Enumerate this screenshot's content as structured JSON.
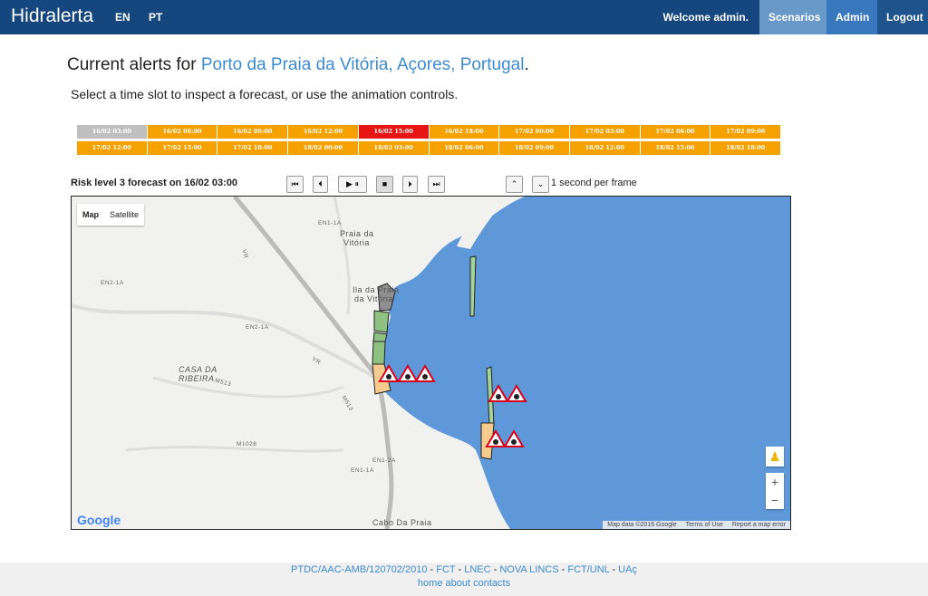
{
  "navbar": {
    "brand": "Hidralerta",
    "lang_en": "EN",
    "lang_pt": "PT",
    "welcome": "Welcome admin.",
    "scenarios": "Scenarios",
    "admin": "Admin",
    "logout": "Logout"
  },
  "header": {
    "title_prefix": "Current alerts for ",
    "location": "Porto da Praia da Vitória, Açores, Portugal",
    "title_suffix": ".",
    "instruction": "Select a time slot to inspect a forecast, or use the animation controls."
  },
  "slots": [
    [
      {
        "label": "16/02 03:00",
        "level": "gray"
      },
      {
        "label": "16/02 06:00",
        "level": "orange"
      },
      {
        "label": "16/02 09:00",
        "level": "orange"
      },
      {
        "label": "16/02 12:00",
        "level": "orange"
      },
      {
        "label": "16/02 15:00",
        "level": "red"
      },
      {
        "label": "16/02 18:00",
        "level": "orange"
      },
      {
        "label": "17/02 00:00",
        "level": "orange"
      },
      {
        "label": "17/02 03:00",
        "level": "orange"
      },
      {
        "label": "17/02 06:00",
        "level": "orange"
      },
      {
        "label": "17/02 09:00",
        "level": "orange"
      }
    ],
    [
      {
        "label": "17/02 12:00",
        "level": "orange"
      },
      {
        "label": "17/02 15:00",
        "level": "orange"
      },
      {
        "label": "17/02 18:00",
        "level": "orange"
      },
      {
        "label": "18/02 00:00",
        "level": "orange"
      },
      {
        "label": "18/02 03:00",
        "level": "orange"
      },
      {
        "label": "18/02 06:00",
        "level": "orange"
      },
      {
        "label": "18/02 09:00",
        "level": "orange"
      },
      {
        "label": "18/02 12:00",
        "level": "orange"
      },
      {
        "label": "18/02 15:00",
        "level": "orange"
      },
      {
        "label": "18/02 18:00",
        "level": "orange"
      }
    ]
  ],
  "colors": {
    "orange": "#f5a100",
    "gray": "#bfbfbf",
    "red": "#e81515",
    "sea": "#5e98d8"
  },
  "controls": {
    "risk_text": "Risk level 3 forecast on 16/02 03:00",
    "first": "⏮",
    "prev": "⏴",
    "playpause": "▶ ⏸",
    "stop": "■",
    "next": "⏵",
    "last": "⏭",
    "up": "⌃",
    "down": "⌄",
    "speed": "1 second per frame"
  },
  "map": {
    "map_btn": "Map",
    "satellite_btn": "Satellite",
    "google": "Google",
    "map_data": "Map data ©2016 Google",
    "terms": "Terms of Use",
    "report": "Report a map error",
    "zoom_in": "+",
    "zoom_out": "−",
    "labels": {
      "praia": "Praia da",
      "vitoria": "Vitória",
      "ila": "Ila da Praia",
      "davitoria": "da Vitória",
      "casa": "CASA DA",
      "ribeira": "RIBEIRA",
      "cabo": "Cabo Da Praia",
      "en1a_top": "EN1-1A",
      "en2a": "EN2-1A",
      "en2b": "EN2-1A",
      "vr1": "VR",
      "vr2": "VR",
      "m513a": "M513",
      "m513b": "M513",
      "m1028": "M1028",
      "en2a_b": "EN1-2A",
      "en1a_b": "EN1-1A"
    }
  },
  "footer": {
    "links": [
      "PTDC/AAC-AMB/120702/2010",
      "FCT",
      "LNEC",
      "NOVA LINCS",
      "FCT/UNL",
      "UAç"
    ],
    "sep": " - ",
    "home": "home",
    "about": "about",
    "contacts": "contacts"
  }
}
